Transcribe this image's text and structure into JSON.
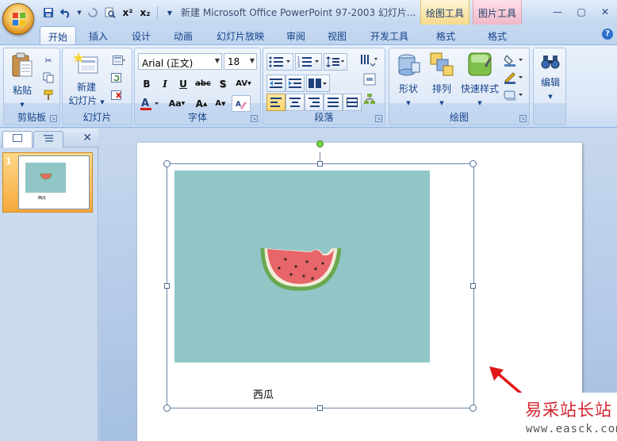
{
  "window": {
    "title": "新建 Microsoft Office PowerPoint 97-2003 幻灯片...",
    "context_tab_drawing": "绘图工具",
    "context_tab_picture": "图片工具"
  },
  "quick_access": [
    "save-icon",
    "undo-icon",
    "redo-icon",
    "print-preview-icon",
    "superscript-icon",
    "subscript-icon",
    "customize-icon"
  ],
  "quick_access_labels": {
    "superscript": "x²",
    "subscript": "x₂"
  },
  "tabs": [
    {
      "label": "开始",
      "active": true
    },
    {
      "label": "插入"
    },
    {
      "label": "设计"
    },
    {
      "label": "动画"
    },
    {
      "label": "幻灯片放映"
    },
    {
      "label": "审阅"
    },
    {
      "label": "视图"
    },
    {
      "label": "开发工具"
    },
    {
      "label": "格式"
    },
    {
      "label": "格式"
    }
  ],
  "ribbon": {
    "clipboard": {
      "label": "剪贴板",
      "paste": "粘贴"
    },
    "slides": {
      "label": "幻灯片",
      "new_slide_line1": "新建",
      "new_slide_line2": "幻灯片"
    },
    "font": {
      "label": "字体",
      "font_name": "Arial (正文)",
      "font_size": "18"
    },
    "paragraph": {
      "label": "段落"
    },
    "drawing": {
      "label": "绘图",
      "shapes": "形状",
      "arrange": "排列",
      "quick_styles": "快速样式"
    },
    "editing": {
      "label": "编辑"
    }
  },
  "slide_panel": {
    "slide_number": "1"
  },
  "slide": {
    "caption": "西瓜"
  },
  "watermark": {
    "text": "易采站长站",
    "url": "www.easck.com"
  },
  "colors": {
    "picture_bg": "#91c6c7",
    "watermelon_flesh": "#e8656a",
    "watermelon_rind": "#6aa84f",
    "font_color_bar": "#d42020",
    "watermark_red": "#d1242f"
  }
}
